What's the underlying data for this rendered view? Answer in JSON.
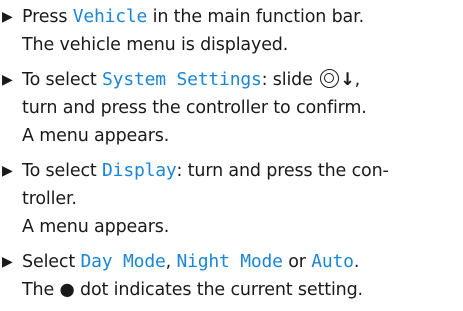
{
  "steps": [
    {
      "line1": {
        "pre": "Press ",
        "ui": "Vehicle",
        "post": " in the main function bar."
      },
      "line2": "The vehicle menu is displayed."
    },
    {
      "line1": {
        "pre": "To select ",
        "ui": "System Settings",
        "post": ": slide "
      },
      "line1_arrow": "↓",
      "line1_end": ",",
      "line2": "turn and press the controller to confirm.",
      "line3": "A menu appears."
    },
    {
      "line1": {
        "pre": "To select ",
        "ui": "Display",
        "post": ": turn and press the con-"
      },
      "line2": "troller.",
      "line3": "A menu appears."
    },
    {
      "line1": {
        "pre": "Select ",
        "ui1": "Day Mode",
        "sep1": ", ",
        "ui2": "Night Mode",
        "sep2": " or ",
        "ui3": "Auto",
        "post": "."
      },
      "line2": "The ● dot indicates the current setting."
    }
  ],
  "bullet_glyph": "▶",
  "icons": {
    "controller": "controller-icon",
    "slide_arrow": "slide-down-arrow-icon",
    "bullet": "step-bullet-icon"
  },
  "colors": {
    "ui_text": "#1b86d6",
    "body_text": "#1a1a1a"
  }
}
